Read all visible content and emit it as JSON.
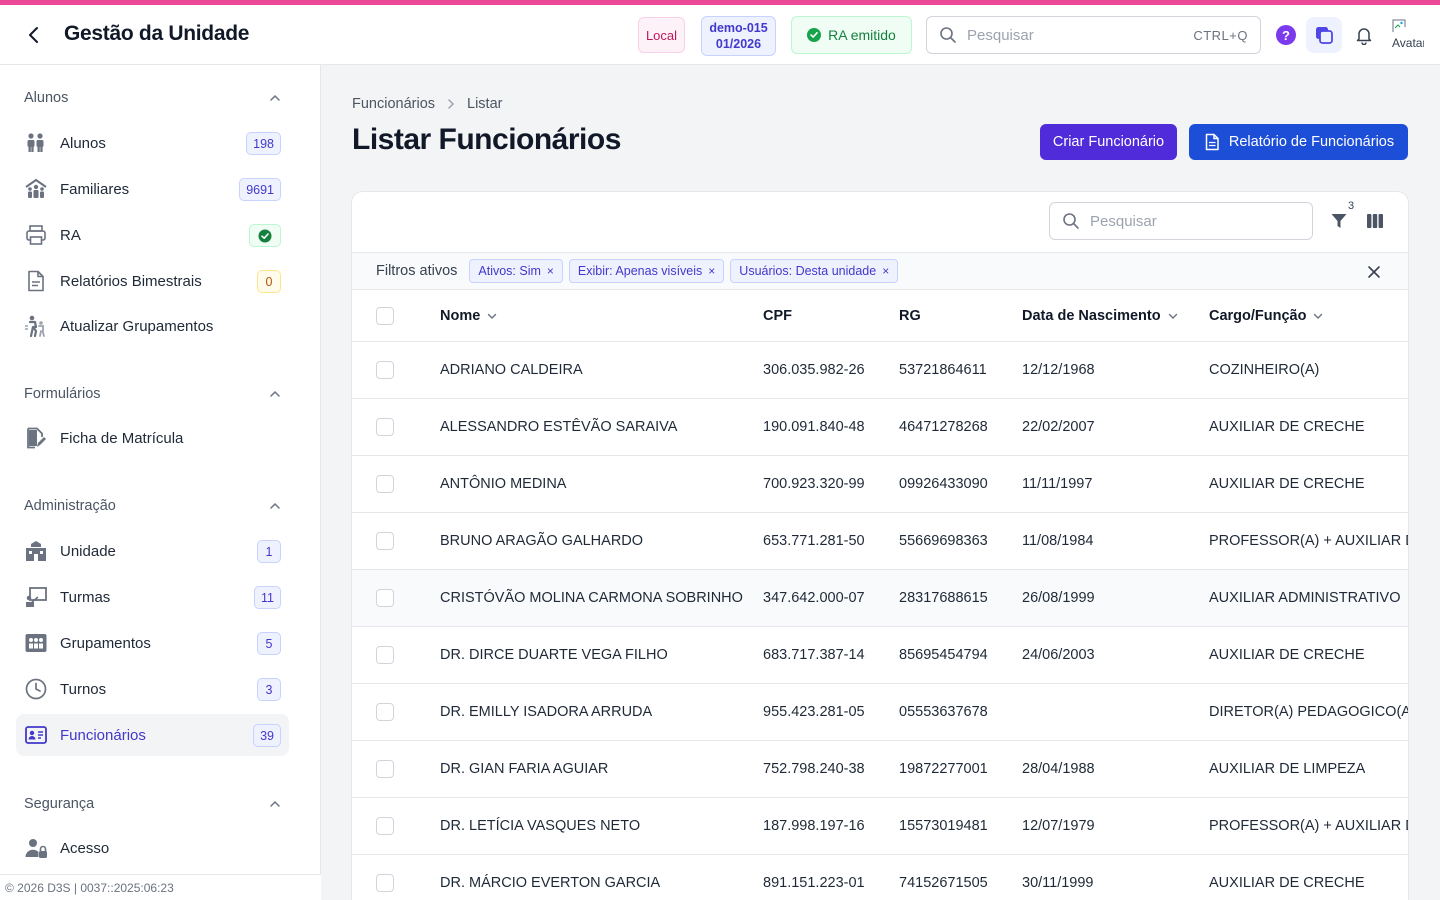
{
  "header": {
    "title": "Gestão da Unidade",
    "badge_local": "Local",
    "badge_demo_line1": "demo-015",
    "badge_demo_line2": "01/2026",
    "badge_ra": "RA emitido",
    "search_placeholder": "Pesquisar",
    "search_shortcut": "CTRL+Q",
    "help_label": "?",
    "avatar_alt": "Avatar"
  },
  "sidebar": {
    "sections": [
      {
        "title": "Alunos"
      },
      {
        "title": "Formulários"
      },
      {
        "title": "Administração"
      },
      {
        "title": "Segurança"
      }
    ],
    "items": [
      {
        "label": "Alunos",
        "count": "198"
      },
      {
        "label": "Familiares",
        "count": "9691"
      },
      {
        "label": "RA",
        "count": ""
      },
      {
        "label": "Relatórios Bimestrais",
        "count": "0"
      },
      {
        "label": "Atualizar Grupamentos",
        "count": ""
      },
      {
        "label": "Ficha de Matrícula",
        "count": ""
      },
      {
        "label": "Unidade",
        "count": "1"
      },
      {
        "label": "Turmas",
        "count": "11"
      },
      {
        "label": "Grupamentos",
        "count": "5"
      },
      {
        "label": "Turnos",
        "count": "3"
      },
      {
        "label": "Funcionários",
        "count": "39"
      },
      {
        "label": "Acesso",
        "count": ""
      }
    ],
    "footer": "© 2026 D3S | 0037::2025:06:23"
  },
  "breadcrumb": {
    "items": [
      "Funcionários",
      "Listar"
    ]
  },
  "page": {
    "title": "Listar Funcionários",
    "create_button": "Criar Funcionário",
    "report_button": "Relatório de Funcionários"
  },
  "table": {
    "search_placeholder": "Pesquisar",
    "filter_count": "3",
    "filters_label": "Filtros ativos",
    "filters": [
      "Ativos: Sim",
      "Exibir: Apenas visíveis",
      "Usuários: Desta unidade"
    ],
    "columns": [
      "Nome",
      "CPF",
      "RG",
      "Data de Nascimento",
      "Cargo/Função"
    ],
    "rows": [
      [
        "ADRIANO CALDEIRA",
        "306.035.982-26",
        "53721864611",
        "12/12/1968",
        "COZINHEIRO(A)"
      ],
      [
        "ALESSANDRO ESTÊVÃO SARAIVA",
        "190.091.840-48",
        "46471278268",
        "22/02/2007",
        "AUXILIAR DE CRECHE"
      ],
      [
        "ANTÔNIO MEDINA",
        "700.923.320-99",
        "09926433090",
        "11/11/1997",
        "AUXILIAR DE CRECHE"
      ],
      [
        "BRUNO ARAGÃO GALHARDO",
        "653.771.281-50",
        "55669698363",
        "11/08/1984",
        "PROFESSOR(A) + AUXILIAR DE CRECHE"
      ],
      [
        "CRISTÓVÃO MOLINA CARMONA SOBRINHO",
        "347.642.000-07",
        "28317688615",
        "26/08/1999",
        "AUXILIAR ADMINISTRATIVO"
      ],
      [
        "DR. DIRCE DUARTE VEGA FILHO",
        "683.717.387-14",
        "85695454794",
        "24/06/2003",
        "AUXILIAR DE CRECHE"
      ],
      [
        "DR. EMILLY ISADORA ARRUDA",
        "955.423.281-05",
        "05553637678",
        "",
        "DIRETOR(A) PEDAGOGICO(A)"
      ],
      [
        "DR. GIAN FARIA AGUIAR",
        "752.798.240-38",
        "19872277001",
        "28/04/1988",
        "AUXILIAR DE LIMPEZA"
      ],
      [
        "DR. LETÍCIA VASQUES NETO",
        "187.998.197-16",
        "15573019481",
        "12/07/1979",
        "PROFESSOR(A) + AUXILIAR DE CRECHE"
      ],
      [
        "DR. MÁRCIO EVERTON GARCIA",
        "891.151.223-01",
        "74152671505",
        "30/11/1999",
        "AUXILIAR DE CRECHE"
      ]
    ]
  },
  "colors": {
    "accent_bar": "#ec4899",
    "primary": "#4f2bd9",
    "report": "#1d4ed8",
    "active_nav": "#4338ca"
  }
}
